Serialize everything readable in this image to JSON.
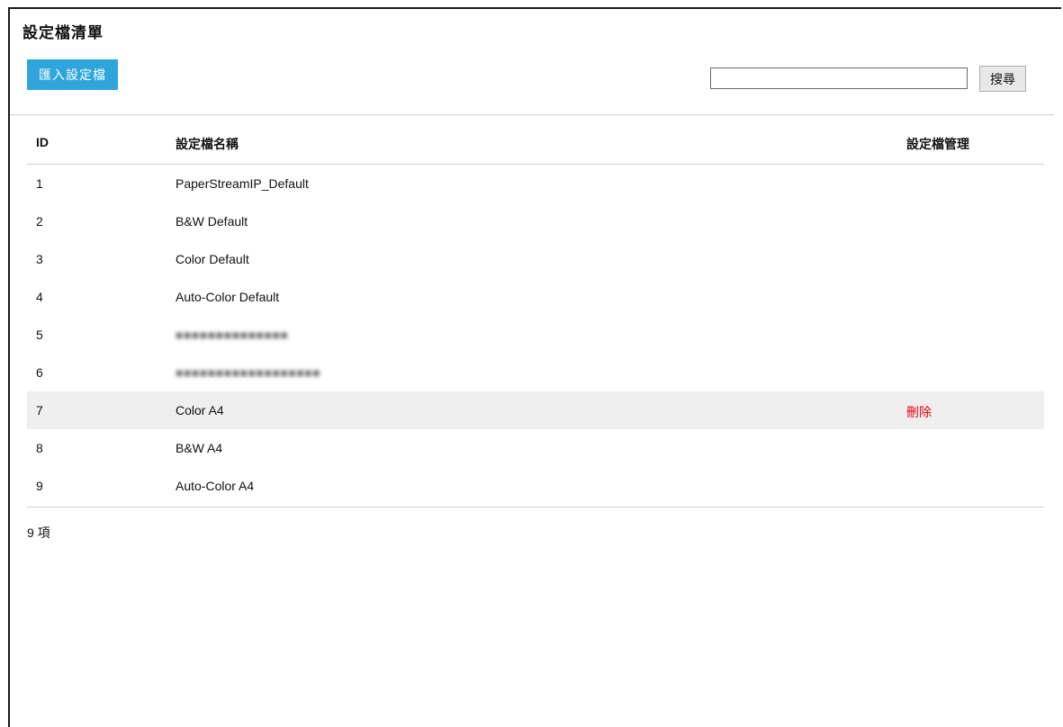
{
  "page": {
    "title": "設定檔清單"
  },
  "toolbar": {
    "import_label": "匯入設定檔",
    "search_value": "",
    "search_label": "搜尋"
  },
  "table": {
    "headers": {
      "id": "ID",
      "name": "設定檔名稱",
      "management": "設定檔管理"
    },
    "rows": [
      {
        "id": "1",
        "name": "PaperStreamIP_Default",
        "action": ""
      },
      {
        "id": "2",
        "name": "B&W Default",
        "action": ""
      },
      {
        "id": "3",
        "name": "Color Default",
        "action": ""
      },
      {
        "id": "4",
        "name": "Auto-Color Default",
        "action": ""
      },
      {
        "id": "5",
        "name": "",
        "action": ""
      },
      {
        "id": "6",
        "name": "",
        "action": ""
      },
      {
        "id": "7",
        "name": "Color A4",
        "action": "刪除"
      },
      {
        "id": "8",
        "name": "B&W A4",
        "action": ""
      },
      {
        "id": "9",
        "name": "Auto-Color A4",
        "action": ""
      }
    ]
  },
  "footer": {
    "count_label": "9 項"
  },
  "colors": {
    "accent": "#2ea6dd",
    "danger": "#e60012",
    "highlight_row": "#efefef"
  }
}
